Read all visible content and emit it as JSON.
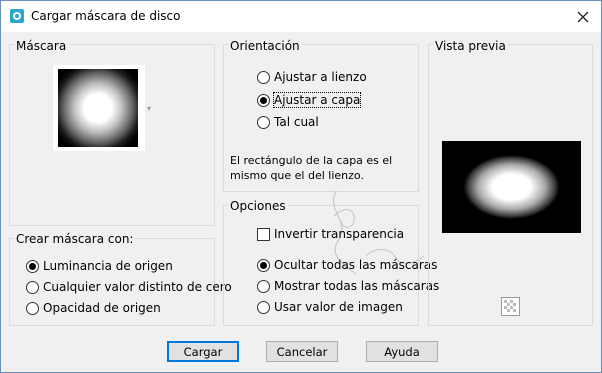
{
  "window": {
    "title": "Cargar máscara de disco",
    "close_icon": "close-icon"
  },
  "mask_group": {
    "label": "Máscara"
  },
  "create_mask_group": {
    "label": "Crear máscara con:",
    "options": [
      {
        "label": "Luminancia de origen",
        "checked": true
      },
      {
        "label": "Cualquier valor distinto de cero",
        "checked": false
      },
      {
        "label": "Opacidad de origen",
        "checked": false
      }
    ]
  },
  "orientation_group": {
    "label": "Orientación",
    "options": [
      {
        "label": "Ajustar a lienzo",
        "checked": false
      },
      {
        "label": "Ajustar a capa",
        "checked": true
      },
      {
        "label": "Tal cual",
        "checked": false
      }
    ],
    "info": "El rectángulo de la capa es el mismo que el del lienzo."
  },
  "options_group": {
    "label": "Opciones",
    "invert": {
      "label": "Invertir transparencia",
      "checked": false
    },
    "options": [
      {
        "label": "Ocultar todas las máscaras",
        "checked": true
      },
      {
        "label": "Mostrar todas las máscaras",
        "checked": false
      },
      {
        "label": "Usar valor de imagen",
        "checked": false
      }
    ]
  },
  "preview_group": {
    "label": "Vista previa"
  },
  "buttons": {
    "ok": "Cargar",
    "cancel": "Cancelar",
    "help": "Ayuda"
  },
  "colors": {
    "accent": "#0078d7",
    "title_bg": "#ffffff",
    "dialog_bg": "#f0f0f0"
  }
}
